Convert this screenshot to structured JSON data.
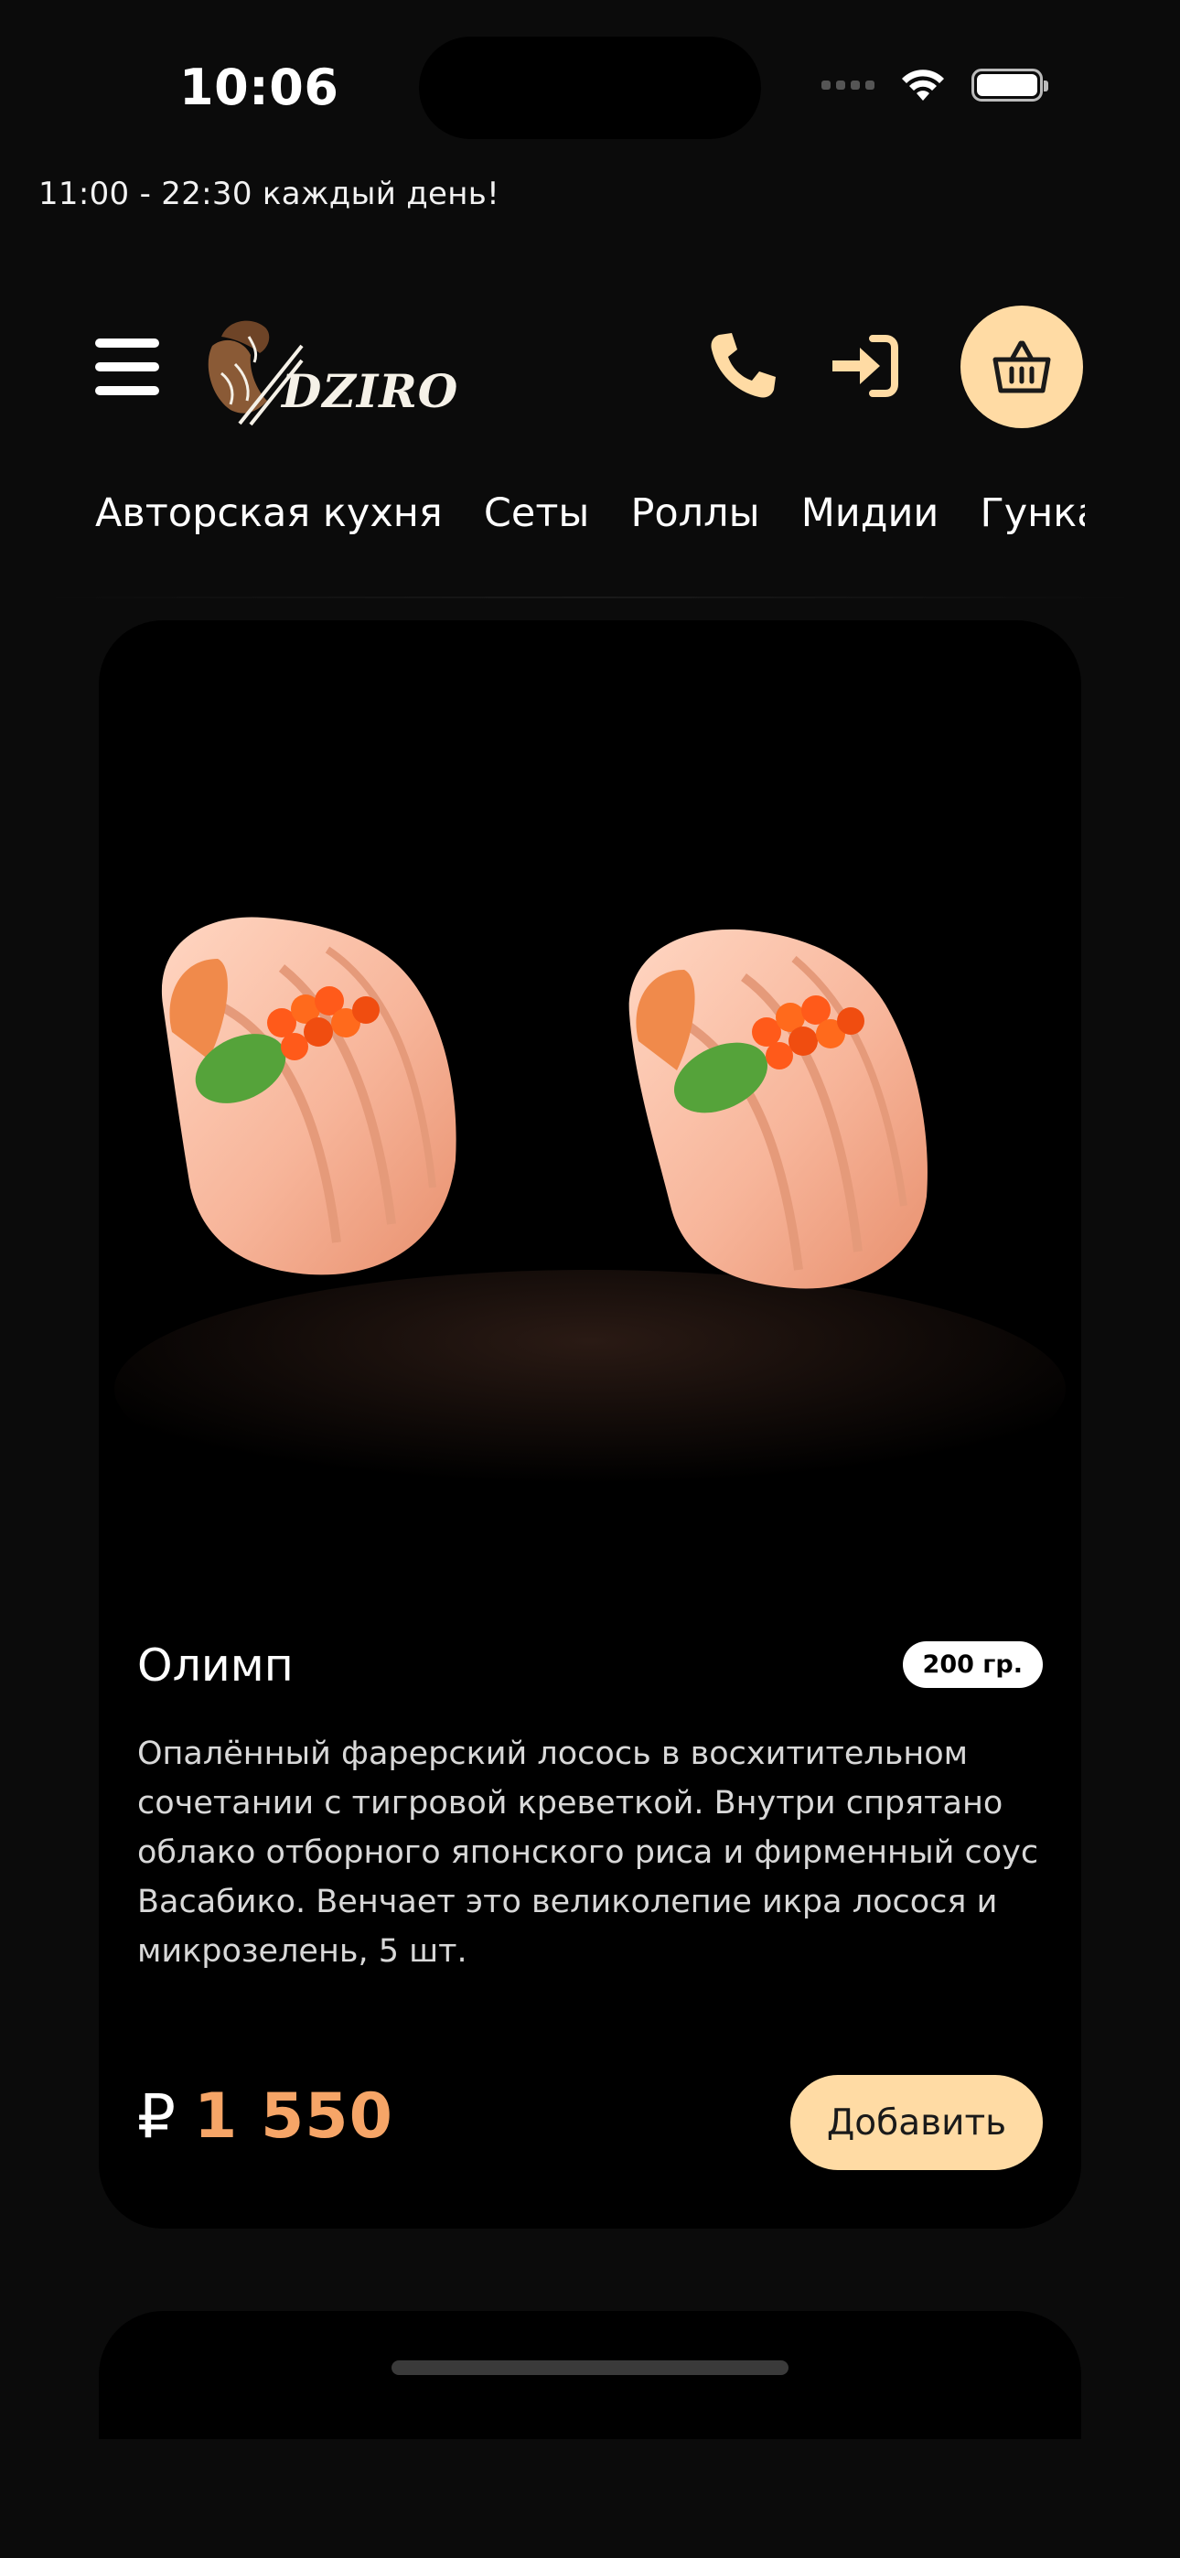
{
  "status_bar": {
    "time": "10:06",
    "icons": [
      "cellular-signal-icon",
      "wifi-icon",
      "battery-icon"
    ]
  },
  "hours_text": "11:00 - 22:30 каждый день!",
  "header": {
    "logo_text": "DZIRO",
    "icons": [
      "menu-icon",
      "phone-icon",
      "login-icon",
      "basket-icon"
    ],
    "accent_color": "#ffdba4"
  },
  "categories": [
    "Авторская кухня",
    "Сеты",
    "Роллы",
    "Мидии",
    "Гунканы"
  ],
  "product": {
    "title": "Олимп",
    "weight": "200 гр.",
    "description": "Опалённый фарерский лосось в восхитительном сочетании с тигровой креветкой. Внутри спрятано облако отборного японского риса и фирменный соус Васабико. Венчает это великолепие икра лосося и микрозелень, 5 шт.",
    "currency_symbol": "₽",
    "price": "1 550",
    "price_color": "#f6a567",
    "add_label": "Добавить"
  }
}
